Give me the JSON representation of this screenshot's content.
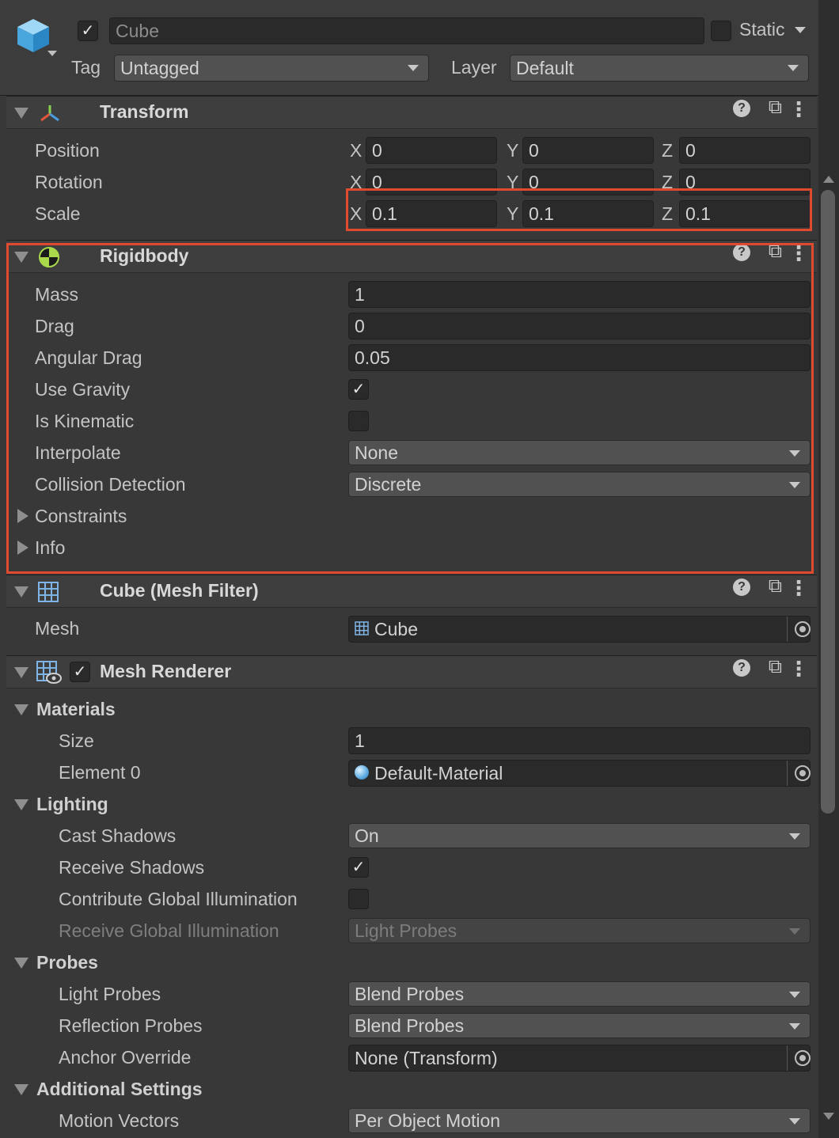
{
  "object": {
    "name": "Cube",
    "active": true,
    "static_label": "Static",
    "tag_label": "Tag",
    "tag_value": "Untagged",
    "layer_label": "Layer",
    "layer_value": "Default"
  },
  "transform": {
    "title": "Transform",
    "position": {
      "label": "Position",
      "x": "0",
      "y": "0",
      "z": "0"
    },
    "rotation": {
      "label": "Rotation",
      "x": "0",
      "y": "0",
      "z": "0"
    },
    "scale": {
      "label": "Scale",
      "x": "0.1",
      "y": "0.1",
      "z": "0.1"
    },
    "axis_x": "X",
    "axis_y": "Y",
    "axis_z": "Z"
  },
  "rigidbody": {
    "title": "Rigidbody",
    "mass_label": "Mass",
    "mass": "1",
    "drag_label": "Drag",
    "drag": "0",
    "angular_drag_label": "Angular Drag",
    "angular_drag": "0.05",
    "use_gravity_label": "Use Gravity",
    "use_gravity": true,
    "is_kinematic_label": "Is Kinematic",
    "is_kinematic": false,
    "interpolate_label": "Interpolate",
    "interpolate": "None",
    "collision_label": "Collision Detection",
    "collision": "Discrete",
    "constraints_label": "Constraints",
    "info_label": "Info"
  },
  "mesh_filter": {
    "title": "Cube (Mesh Filter)",
    "mesh_label": "Mesh",
    "mesh": "Cube"
  },
  "mesh_renderer": {
    "title": "Mesh Renderer",
    "enabled": true,
    "materials_label": "Materials",
    "size_label": "Size",
    "size": "1",
    "element0_label": "Element 0",
    "element0": "Default-Material",
    "lighting_label": "Lighting",
    "cast_shadows_label": "Cast Shadows",
    "cast_shadows": "On",
    "receive_shadows_label": "Receive Shadows",
    "receive_shadows": true,
    "contribute_gi_label": "Contribute Global Illumination",
    "contribute_gi": false,
    "receive_gi_label": "Receive Global Illumination",
    "receive_gi": "Light Probes",
    "probes_label": "Probes",
    "light_probes_label": "Light Probes",
    "light_probes": "Blend Probes",
    "reflection_probes_label": "Reflection Probes",
    "reflection_probes": "Blend Probes",
    "anchor_label": "Anchor Override",
    "anchor": "None (Transform)",
    "additional_label": "Additional Settings",
    "motion_vectors_label": "Motion Vectors",
    "motion_vectors": "Per Object Motion"
  },
  "icons": {
    "help": "?",
    "presets": "⧉",
    "kebab": "⋮",
    "check": "✓"
  },
  "colors": {
    "background": "#383838",
    "highlight": "#e04a2e",
    "field": "#2a2a2a"
  }
}
